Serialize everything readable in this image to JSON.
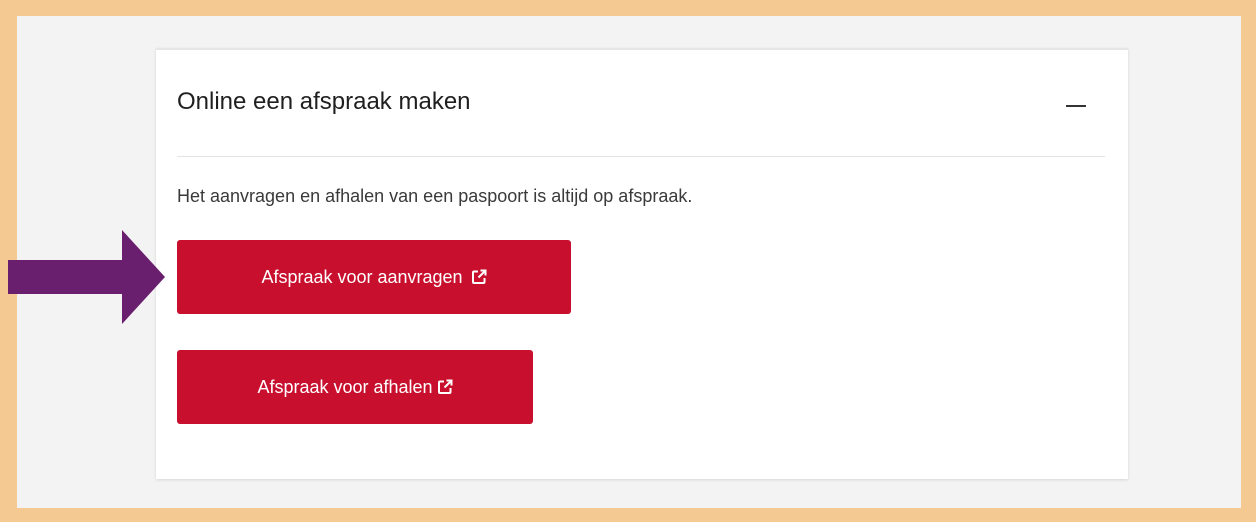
{
  "card": {
    "title": "Online een afspraak maken",
    "intro": "Het aanvragen en afhalen van een paspoort is altijd op afspraak."
  },
  "buttons": [
    {
      "label": "Afspraak voor aanvragen",
      "icon": "external-link-icon"
    },
    {
      "label": "Afspraak voor afhalen",
      "icon": "external-link-icon"
    }
  ],
  "colors": {
    "frame": "#f5c992",
    "page_background": "#f3f3f3",
    "button": "#c8102e",
    "annotation_arrow": "#6a1e6e"
  }
}
